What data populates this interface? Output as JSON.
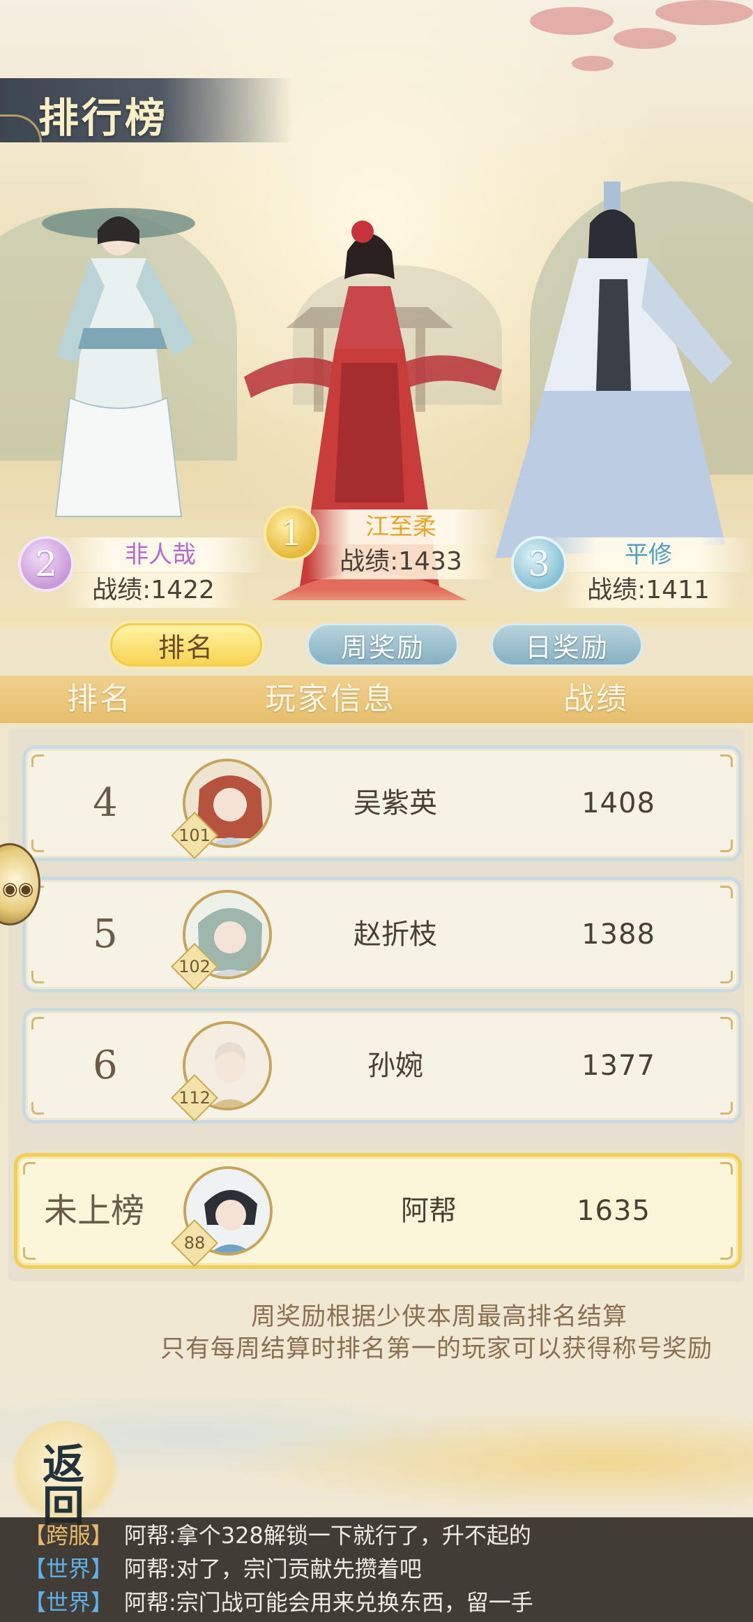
{
  "page": {
    "title": "排行榜"
  },
  "podium": [
    {
      "rank": "1",
      "name": "江至柔",
      "score_text": "战绩:1433",
      "name_color": "#e1a82c"
    },
    {
      "rank": "2",
      "name": "非人哉",
      "score_text": "战绩:1422",
      "name_color": "#b56ad0"
    },
    {
      "rank": "3",
      "name": "平修",
      "score_text": "战绩:1411",
      "name_color": "#4f9fc0"
    }
  ],
  "tabs": [
    {
      "label": "排名",
      "active": true
    },
    {
      "label": "周奖励",
      "active": false
    },
    {
      "label": "日奖励",
      "active": false
    }
  ],
  "list_header": {
    "rank": "排名",
    "player_info": "玩家信息",
    "score": "战绩"
  },
  "rows": [
    {
      "rank": "4",
      "name": "吴紫英",
      "score": "1408",
      "level": "101"
    },
    {
      "rank": "5",
      "name": "赵折枝",
      "score": "1388",
      "level": "102"
    },
    {
      "rank": "6",
      "name": "孙婉",
      "score": "1377",
      "level": "112"
    }
  ],
  "my_row": {
    "rank": "未上榜",
    "name": "阿帮",
    "score": "1635",
    "level": "88"
  },
  "notes": [
    "周奖励根据少侠本周最高排名结算",
    "只有每周结算时排名第一的玩家可以获得称号奖励"
  ],
  "back_button": {
    "line1": "返",
    "line2": "回"
  },
  "chat": [
    {
      "channel": "【跨服】",
      "channel_color": "#e6b86a",
      "sender": "阿帮:",
      "text": "拿个328解锁一下就行了，升不起的"
    },
    {
      "channel": "【世界】",
      "channel_color": "#5fb0e6",
      "sender": "阿帮:",
      "text": "对了，宗门贡献先攒着吧"
    },
    {
      "channel": "【世界】",
      "channel_color": "#5fb0e6",
      "sender": "阿帮:",
      "text": "宗门战可能会用来兑换东西，留一手"
    }
  ]
}
